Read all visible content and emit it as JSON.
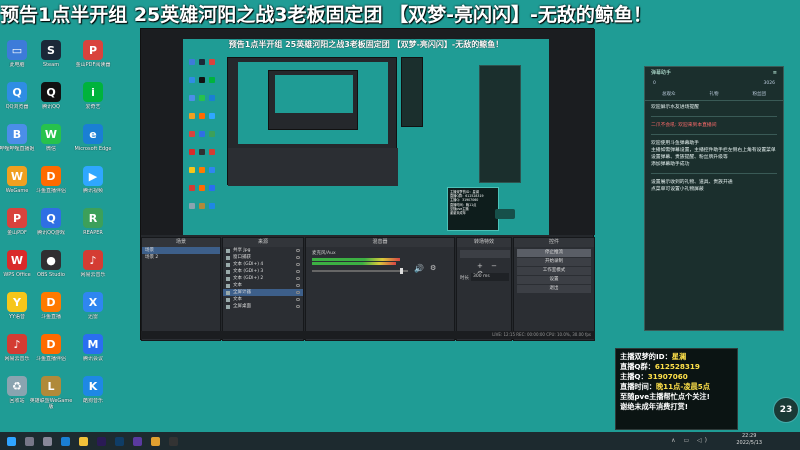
{
  "banner": {
    "text": "预告1点半开组 25英雄河阳之战3老板固定团 【双梦-亮闪闪】-无敌的鲸鱼！"
  },
  "desktop_icons": [
    {
      "label": "此电脑",
      "color": "#3d7bd9",
      "glyph": "▭"
    },
    {
      "label": "Steam",
      "color": "#1b2838",
      "glyph": "S"
    },
    {
      "label": "金山PDF阅读器",
      "color": "#d9433d",
      "glyph": "P"
    },
    {
      "label": "QQ浏览器",
      "color": "#2f8de4",
      "glyph": "Q"
    },
    {
      "label": "腾讯QQ",
      "color": "#111111",
      "glyph": "Q"
    },
    {
      "label": "爱奇艺",
      "color": "#00b33c",
      "glyph": "i"
    },
    {
      "label": "哔哩哔哩直播姬",
      "color": "#4b8ee8",
      "glyph": "B"
    },
    {
      "label": "微信",
      "color": "#27c24c",
      "glyph": "W"
    },
    {
      "label": "Microsoft Edge",
      "color": "#1a7fd4",
      "glyph": "e"
    },
    {
      "label": "WeGame",
      "color": "#f0a020",
      "glyph": "W"
    },
    {
      "label": "斗鱼直播伴侣",
      "color": "#ff6a00",
      "glyph": "D"
    },
    {
      "label": "腾讯视频",
      "color": "#2fa7ff",
      "glyph": "▶"
    },
    {
      "label": "金山PDF",
      "color": "#d9433d",
      "glyph": "P"
    },
    {
      "label": "腾讯QQ游戏",
      "color": "#2f6fe4",
      "glyph": "Q"
    },
    {
      "label": "REAPER",
      "color": "#3ca05a",
      "glyph": "R"
    },
    {
      "label": "WPS Office",
      "color": "#d92a2a",
      "glyph": "W"
    },
    {
      "label": "OBS Studio",
      "color": "#302e31",
      "glyph": "●"
    },
    {
      "label": "网易云音乐",
      "color": "#d43c33",
      "glyph": "♪"
    },
    {
      "label": "YY语音",
      "color": "#f6c61a",
      "glyph": "Y"
    },
    {
      "label": "斗鱼直播",
      "color": "#ff7a00",
      "glyph": "D"
    },
    {
      "label": "迅雷",
      "color": "#2f86f0",
      "glyph": "X"
    },
    {
      "label": "网易云音乐",
      "color": "#d43c33",
      "glyph": "♪"
    },
    {
      "label": "斗鱼直播伴侣",
      "color": "#ff6a00",
      "glyph": "D"
    },
    {
      "label": "腾讯会议",
      "color": "#2a6ef0",
      "glyph": "M"
    },
    {
      "label": "回收站",
      "color": "#8aa4b0",
      "glyph": "♻"
    },
    {
      "label": "英雄联盟WeGame版",
      "color": "#b08a3a",
      "glyph": "L"
    },
    {
      "label": "酷狗音乐",
      "color": "#1e88e5",
      "glyph": "K"
    }
  ],
  "obs": {
    "preview_title": "预告1点半开组 25英雄河阳之战3老板固定团 【双梦-亮闪闪】-无敌的鲸鱼！",
    "preview_info": [
      "主播双梦的ID：星澜",
      "直播Q群：612528319",
      "主播Q：31907060",
      "直播时间：晚11点",
      "至随pve主播",
      "谢谢未成年"
    ],
    "scenes": {
      "header": "场景",
      "items": [
        "场景",
        "场景 2"
      ]
    },
    "sources": {
      "header": "来源",
      "items": [
        "共享 Jpg",
        "窗口捕获",
        "文本 (GDI+) 4",
        "文本 (GDI+) 3",
        "文本 (GDI+) 2",
        "文本",
        "全屏计器",
        "文本",
        "全屏桌面"
      ]
    },
    "mixer": {
      "header": "混音器",
      "label": "麦克风/Aux"
    },
    "transitions": {
      "header": "转场特效",
      "duration_label": "时长",
      "duration_value": "300 ms"
    },
    "controls": {
      "header": "控件",
      "buttons": [
        "停止推流",
        "开始录制",
        "工作室模式",
        "设置",
        "退出"
      ]
    },
    "statusbar": "LIVE: 12:15   REC: 00:00:00   CPU: 10.0%, 30.00 fps"
  },
  "chat": {
    "title": "弹幕助手",
    "stats_left": "0",
    "stats_right": "3026",
    "tabs": [
      "总观众",
      "礼物",
      "粉丝团"
    ],
    "messages": [
      "欢迎屏示水友进场提醒",
      "二爪不会吼: 欢迎来到本直播间",
      "欢迎使用斗鱼弹幕助手\n主播如需弹幕设置，主播控件助手栏左侧右上角有设置菜单\n设置弹幕、贵族提醒、粉丝牌升级等\n添加弹幕助手成功",
      "设置展示收到的礼物、道具、贵族开通\n点菜单可设置小礼物屏蔽"
    ]
  },
  "info": {
    "lines": [
      {
        "label": "主播双梦的ID：",
        "value": "星澜"
      },
      {
        "label": "直播Q群：",
        "value": "612528319"
      },
      {
        "label": "主播Q：",
        "value": "31907060"
      },
      {
        "label": "直播时间：",
        "value": "晚11点-凌晨5点"
      },
      {
        "label": "至随pve主播帮忙点个关注!",
        "value": ""
      },
      {
        "label": "谢绝未成年消费打赏!",
        "value": ""
      }
    ]
  },
  "badge": "23",
  "taskbar": {
    "time": "22:29",
    "date": "2022/5/13",
    "apps": [
      {
        "name": "start",
        "color": "#2fa4ff"
      },
      {
        "name": "search",
        "color": "#778"
      },
      {
        "name": "task-view",
        "color": "#889"
      },
      {
        "name": "edge",
        "color": "#1a7fd4"
      },
      {
        "name": "explorer",
        "color": "#f2c13a"
      },
      {
        "name": "premiere",
        "color": "#2a1a55"
      },
      {
        "name": "photoshop",
        "color": "#0f3d66"
      },
      {
        "name": "app-purple",
        "color": "#5a3aa0"
      },
      {
        "name": "chrome",
        "color": "#e0a030"
      },
      {
        "name": "obs",
        "color": "#333"
      }
    ]
  }
}
